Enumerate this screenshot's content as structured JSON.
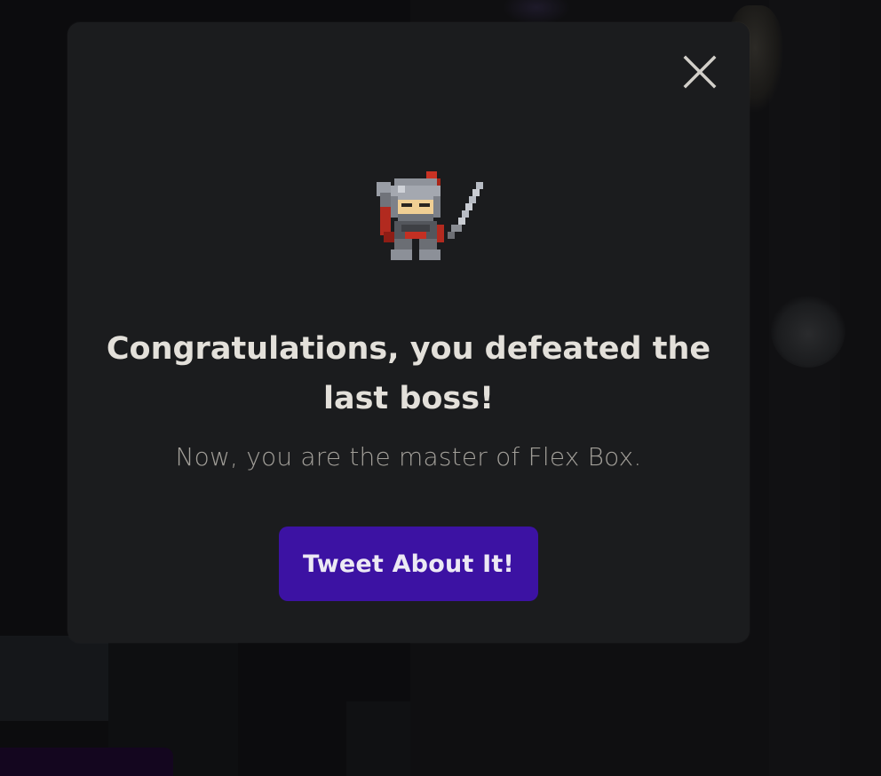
{
  "modal": {
    "title_line1": "Congratulations, you defeated the",
    "title_line2": "last boss!",
    "subtitle": "Now, you are the master of Flex Box.",
    "button_label": "Tweet About It!",
    "close_icon": "close-icon",
    "hero_icon": "knight-sprite"
  },
  "colors": {
    "modal_bg": "#1b1c1e",
    "button_bg": "#3c12a3",
    "title_text": "#e3e0da",
    "subtitle_text": "#a29f99"
  }
}
